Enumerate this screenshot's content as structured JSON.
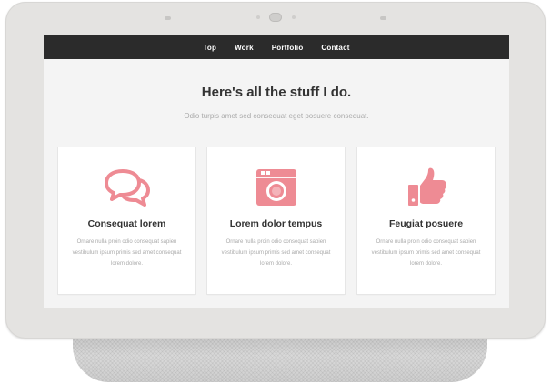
{
  "nav": {
    "items": [
      "Top",
      "Work",
      "Portfolio",
      "Contact"
    ]
  },
  "hero": {
    "title": "Here's all the stuff I do.",
    "subtitle": "Odio turpis amet sed consequat eget posuere consequat."
  },
  "features": [
    {
      "icon": "chat-bubbles-icon",
      "title": "Consequat lorem",
      "text": "Ornare nulla proin odio consequat sapien vestibulum ipsum primis sed amet consequat lorem dolore."
    },
    {
      "icon": "camera-icon",
      "title": "Lorem dolor tempus",
      "text": "Ornare nulla proin odio consequat sapien vestibulum ipsum primis sed amet consequat lorem dolore."
    },
    {
      "icon": "thumbs-up-icon",
      "title": "Feugiat posuere",
      "text": "Ornare nulla proin odio consequat sapien vestibulum ipsum primis sed amet consequat lorem dolore."
    }
  ],
  "colors": {
    "accent": "#ee8b94",
    "nav_bg": "#2b2b2b",
    "screen_bg": "#f4f4f4",
    "device_frame": "#e4e3e1"
  }
}
